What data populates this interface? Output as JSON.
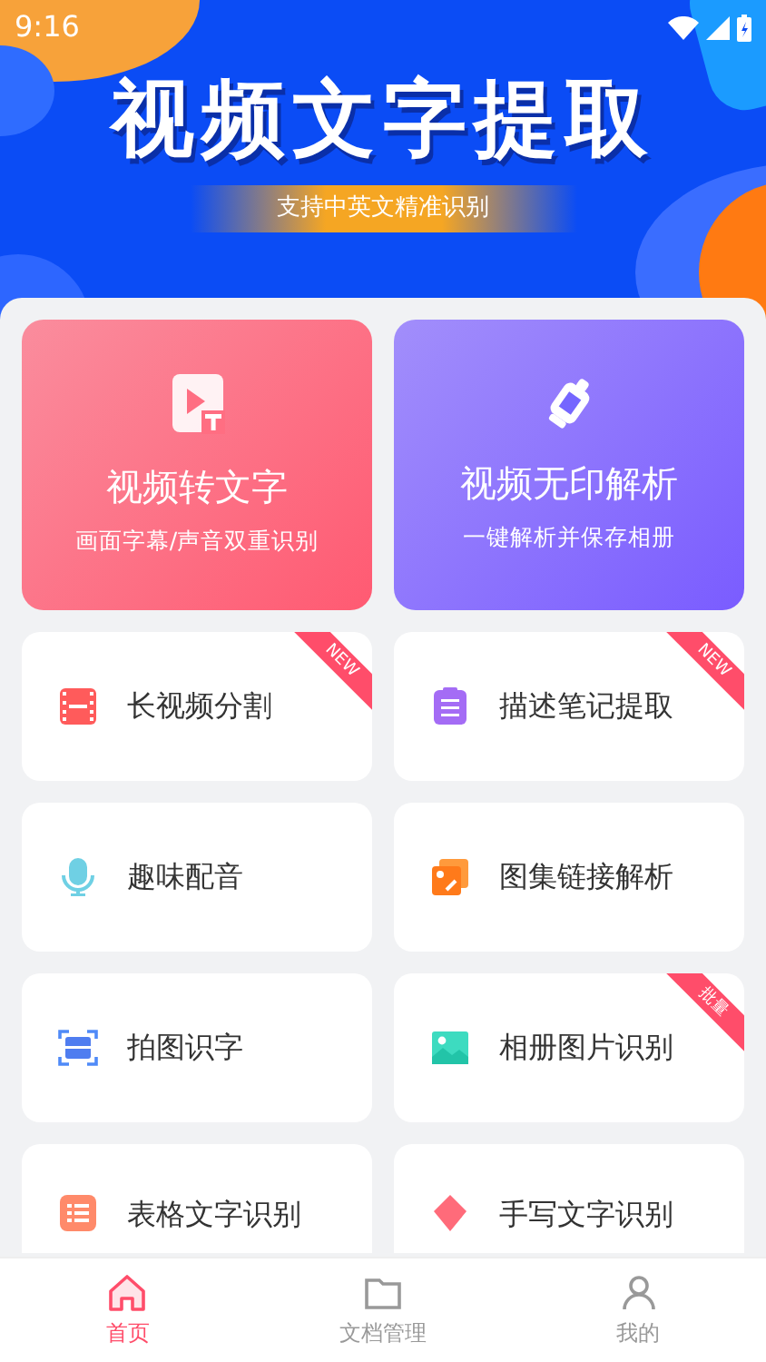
{
  "status_bar": {
    "time": "9:16"
  },
  "banner": {
    "title": "视频文字提取",
    "subtitle": "支持中英文精准识别"
  },
  "main_cards": [
    {
      "title": "视频转文字",
      "subtitle": "画面字幕/声音双重识别",
      "color": "#ff5a72"
    },
    {
      "title": "视频无印解析",
      "subtitle": "一键解析并保存相册",
      "color": "#7a5cff"
    }
  ],
  "tools": [
    {
      "label": "长视频分割",
      "badge": "NEW"
    },
    {
      "label": "描述笔记提取",
      "badge": "NEW"
    },
    {
      "label": "趣味配音"
    },
    {
      "label": "图集链接解析"
    },
    {
      "label": "拍图识字"
    },
    {
      "label": "相册图片识别",
      "badge": "批量"
    },
    {
      "label": "表格文字识别"
    },
    {
      "label": "手写文字识别"
    }
  ],
  "bottom_nav": [
    {
      "label": "首页",
      "selected": true
    },
    {
      "label": "文档管理",
      "selected": false
    },
    {
      "label": "我的",
      "selected": false
    }
  ]
}
